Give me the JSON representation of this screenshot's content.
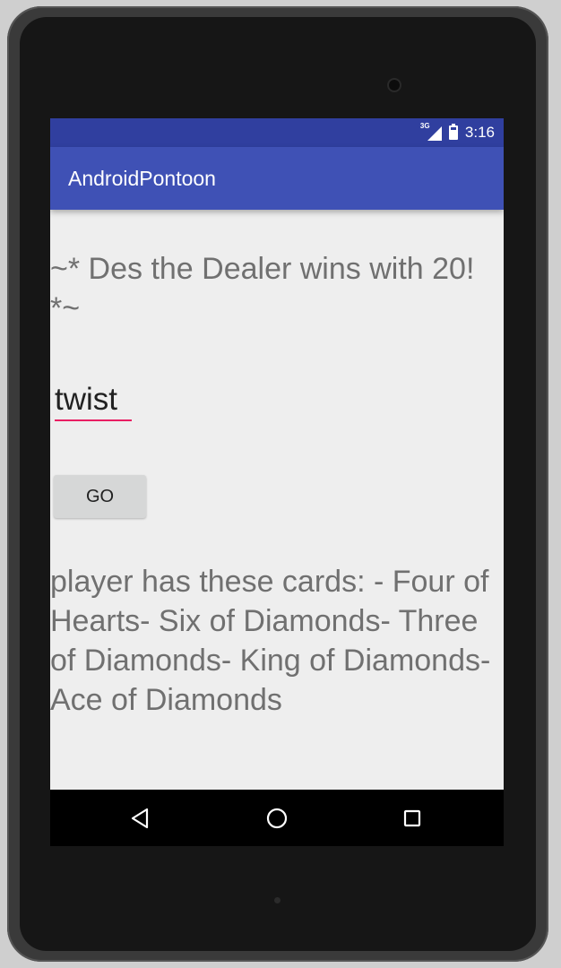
{
  "status_bar": {
    "time": "3:16",
    "network_label": "3G",
    "icons": [
      "signal-3g-icon",
      "battery-charging-icon"
    ]
  },
  "app_bar": {
    "title": "AndroidPontoon",
    "background_color": "#3f51b5",
    "status_color": "#303f9f"
  },
  "main": {
    "result_text": "~* Des the Dealer wins with 20! *~",
    "command_input_value": "twist",
    "go_button_label": "GO",
    "cards_text": "player has these cards: - Four of Hearts- Six of Diamonds- Three of Diamonds- King of Diamonds- Ace of Diamonds",
    "accent_color": "#e91e63"
  },
  "nav_bar": {
    "buttons": [
      "back-icon",
      "home-icon",
      "recent-apps-icon"
    ]
  }
}
